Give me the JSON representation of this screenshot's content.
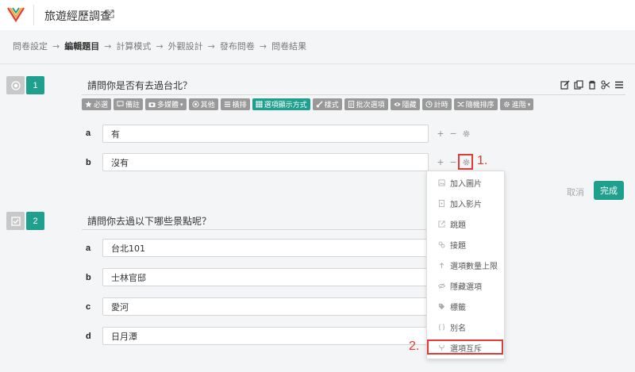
{
  "app": {
    "title": "旅遊經歷調查"
  },
  "steps": [
    {
      "label": "問卷設定",
      "active": false
    },
    {
      "label": "編輯題目",
      "active": true
    },
    {
      "label": "計算模式",
      "active": false
    },
    {
      "label": "外觀設計",
      "active": false
    },
    {
      "label": "發布問卷",
      "active": false
    },
    {
      "label": "問卷結果",
      "active": false
    }
  ],
  "step_arrow": "→",
  "question1": {
    "number": "1",
    "title": "請問你是否有去過台北？",
    "toolbar": [
      {
        "label": "必選",
        "icon": "star-icon"
      },
      {
        "label": "備註",
        "icon": "comment-icon"
      },
      {
        "label": "多媒體",
        "icon": "camera-icon",
        "caret": true
      },
      {
        "label": "其他",
        "icon": "circle-dot-icon"
      },
      {
        "label": "橫排",
        "icon": "list-icon"
      },
      {
        "label": "選項顯示方式",
        "icon": "grid-icon",
        "active": true
      },
      {
        "label": "樣式",
        "icon": "brush-icon"
      },
      {
        "label": "批次選項",
        "icon": "doc-icon"
      },
      {
        "label": "隱藏",
        "icon": "eye-icon"
      },
      {
        "label": "計時",
        "icon": "clock-icon"
      },
      {
        "label": "隨機排序",
        "icon": "shuffle-icon"
      },
      {
        "label": "進階",
        "icon": "gear-icon",
        "caret": true
      }
    ],
    "options": [
      {
        "letter": "a",
        "value": "有"
      },
      {
        "letter": "b",
        "value": "沒有"
      }
    ],
    "cancel_label": "取消",
    "done_label": "完成"
  },
  "question2": {
    "number": "2",
    "title": "請問你去過以下哪些景點呢？",
    "options": [
      {
        "letter": "a",
        "value": "台北101"
      },
      {
        "letter": "b",
        "value": "士林官邸"
      },
      {
        "letter": "c",
        "value": "愛河"
      },
      {
        "letter": "d",
        "value": "日月潭"
      }
    ]
  },
  "option_controls": {
    "add": "+",
    "remove": "−"
  },
  "annotations": {
    "step1": "1.",
    "step2": "2."
  },
  "dropdown_menu": [
    {
      "label": "加入圖片",
      "icon": "image-icon"
    },
    {
      "label": "加入影片",
      "icon": "video-icon"
    },
    {
      "label": "跳題",
      "icon": "external-link-icon"
    },
    {
      "label": "接題",
      "icon": "link-icon"
    },
    {
      "label": "選項數量上限",
      "icon": "upload-icon"
    },
    {
      "label": "隱藏選項",
      "icon": "eye-slash-icon"
    },
    {
      "label": "標籤",
      "icon": "tag-icon"
    },
    {
      "label": "別名",
      "icon": "braces-icon"
    },
    {
      "label": "選項互斥",
      "icon": "fork-icon",
      "highlighted": true
    }
  ],
  "colors": {
    "accent": "#1f9f8d",
    "annotation": "#e53935",
    "tool_gray": "#999999"
  }
}
